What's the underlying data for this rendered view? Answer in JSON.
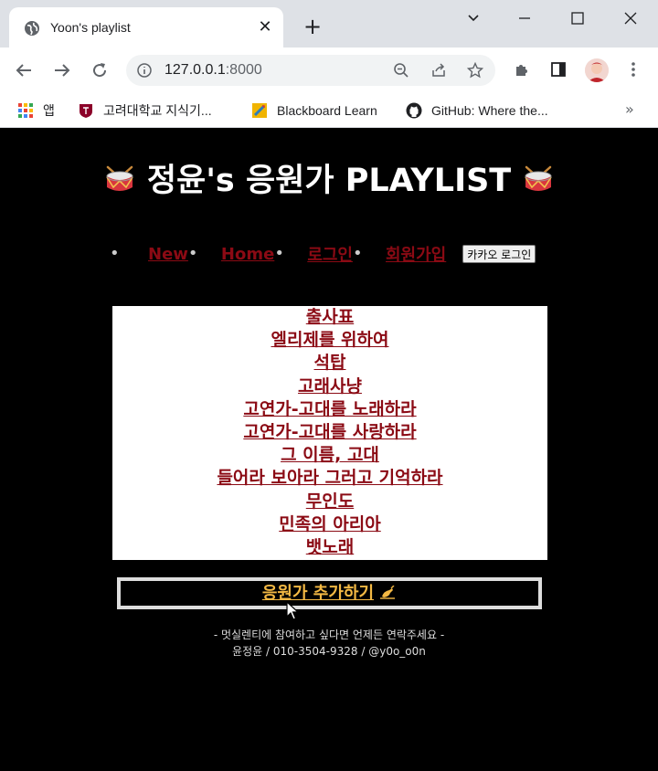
{
  "browser": {
    "tab_title": "Yoon's playlist",
    "url_host": "127.0.0.1",
    "url_port": ":8000",
    "bookmarks": [
      {
        "label": "앱",
        "icon": "apps-grid-icon"
      },
      {
        "label": "고려대학교 지식기...",
        "icon": "korea-univ-icon"
      },
      {
        "label": "Blackboard Learn",
        "icon": "blackboard-icon"
      },
      {
        "label": "GitHub: Where the...",
        "icon": "github-icon"
      }
    ],
    "more_label": "»"
  },
  "site": {
    "title": "정윤's 응원가 PLAYLIST",
    "nav": {
      "new": "New",
      "home": "Home",
      "login": "로그인",
      "signup": "회원가입",
      "kakao": "카카오 로그인"
    },
    "songs": [
      "출사표",
      "엘리제를 위하여",
      "석탑",
      "고래사냥",
      "고연가-고대를 노래하라",
      "고연가-고대를 사랑하라",
      "그 이름, 고대",
      "들어라 보아라 그러고 기억하라",
      "무인도",
      "민족의 아리아",
      "뱃노래"
    ],
    "add_label": "응원가 추가하기",
    "footer_line1": "- 멋실렌티에 참여하고 싶다면 언제든 연락주세요 -",
    "footer_line2": "윤정윤 / 010-3504-9328 / @y0o_o0n"
  },
  "colors": {
    "link": "#8b0a14",
    "add_link": "#f4b944",
    "page_bg": "#000000"
  }
}
